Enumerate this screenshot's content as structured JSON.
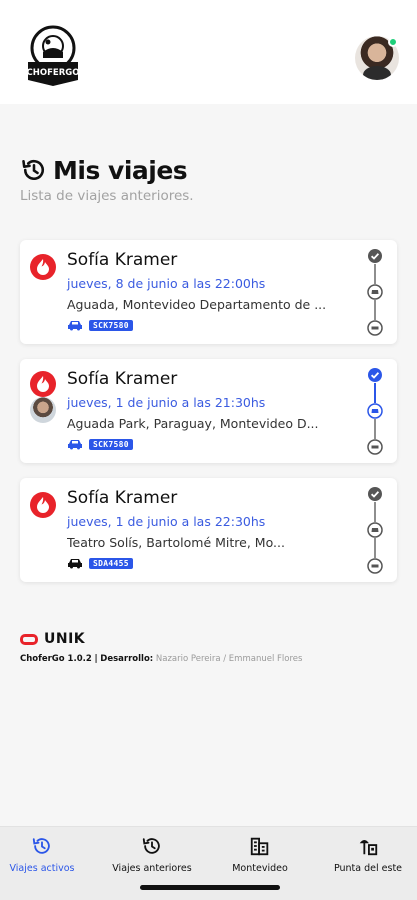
{
  "app": {
    "logo_text": "CHOFERGO",
    "user_status": "online"
  },
  "page": {
    "title": "Mis viajes",
    "subtitle": "Lista de viajes anteriores."
  },
  "trips": [
    {
      "name": "Sofía Kramer",
      "date": "jueves, 8 de junio a las 22:00hs",
      "address": "Aguada, Montevideo Departamento de ...",
      "plate": "SCK7580",
      "vehicle_color": "#2b56e8",
      "has_driver_photo": false,
      "status": "completed"
    },
    {
      "name": "Sofía Kramer",
      "date": "jueves, 1 de junio a las 21:30hs",
      "address": "Aguada Park, Paraguay, Montevideo D...",
      "plate": "SCK7580",
      "vehicle_color": "#2b56e8",
      "has_driver_photo": true,
      "status": "active"
    },
    {
      "name": "Sofía Kramer",
      "date": "jueves, 1 de junio a las 22:30hs",
      "address": "Teatro Solís, Bartolomé Mitre, Mo...",
      "plate": "SDA4455",
      "vehicle_color": "#111111",
      "has_driver_photo": false,
      "status": "completed"
    }
  ],
  "footer": {
    "brand": "UNIK",
    "version": "ChoferGo 1.0.2",
    "separator": "|",
    "dev_label": "Desarrollo:",
    "developers": "Nazario Pereira / Emmanuel Flores"
  },
  "tabs": [
    {
      "label": "Viajes activos",
      "icon": "history-icon",
      "active": true
    },
    {
      "label": "Viajes anteriores",
      "icon": "history-icon",
      "active": false
    },
    {
      "label": "Montevideo",
      "icon": "city-buildings-icon",
      "active": false
    },
    {
      "label": "Punta del este",
      "icon": "beach-icon",
      "active": false
    }
  ],
  "colors": {
    "accent": "#2b56e8",
    "brand_red": "#e8232a",
    "status_completed": "#555555",
    "status_active": "#2b56e8"
  }
}
